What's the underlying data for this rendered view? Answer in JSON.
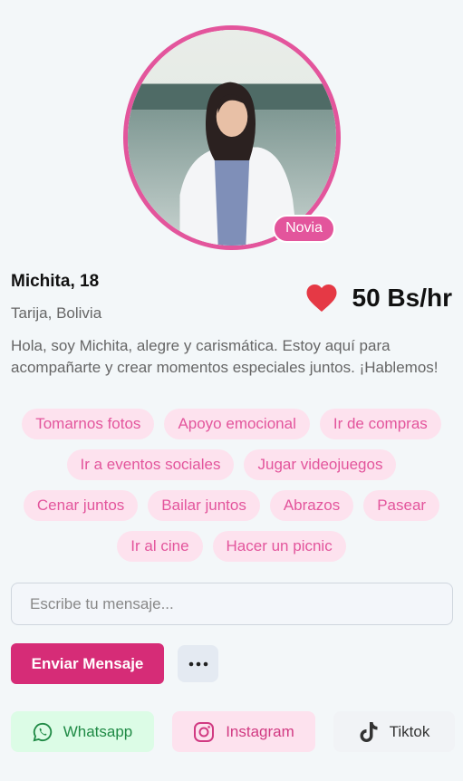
{
  "profile": {
    "badge": "Novia",
    "name": "Michita, 18",
    "location": "Tarija, Bolivia",
    "price": "50 Bs/hr",
    "bio": "Hola, soy Michita, alegre y carismática. Estoy aquí para acompañarte y crear momentos especiales juntos. ¡Hablemos!"
  },
  "tags": [
    "Tomarnos fotos",
    "Apoyo emocional",
    "Ir de compras",
    "Ir a eventos sociales",
    "Jugar videojuegos",
    "Cenar juntos",
    "Bailar juntos",
    "Abrazos",
    "Pasear",
    "Ir al cine",
    "Hacer un picnic"
  ],
  "message": {
    "value": "",
    "placeholder": "Escribe tu mensaje...",
    "send_label": "Enviar Mensaje",
    "more_icon": "more-horizontal-icon"
  },
  "social": {
    "whatsapp": "Whatsapp",
    "instagram": "Instagram",
    "tiktok": "Tiktok"
  },
  "colors": {
    "accent": "#e3559c",
    "send_button": "#d62c77",
    "heart": "#e53945",
    "whatsapp": "#1f8a45"
  }
}
